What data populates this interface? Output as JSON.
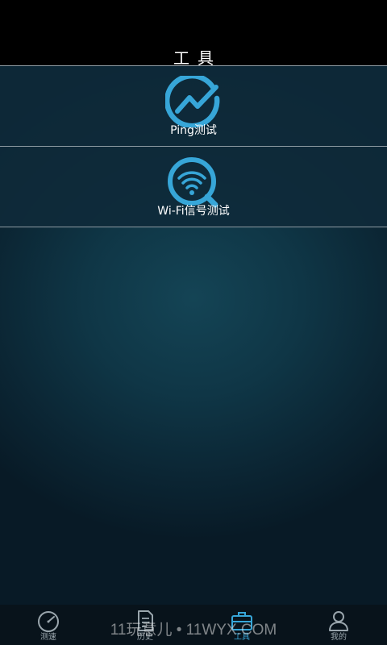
{
  "header": {
    "title": "工具"
  },
  "tools": [
    {
      "label": "Ping测试",
      "icon": "ping-chart-icon"
    },
    {
      "label": "Wi-Fi信号测试",
      "icon": "wifi-search-icon"
    }
  ],
  "bottom_nav": [
    {
      "label": "测速",
      "icon": "speedometer-icon",
      "active": false
    },
    {
      "label": "历史",
      "icon": "document-icon",
      "active": false
    },
    {
      "label": "工具",
      "icon": "toolbox-icon",
      "active": true
    },
    {
      "label": "我的",
      "icon": "user-icon",
      "active": false
    }
  ],
  "watermark": "11玩意儿 • 11WYX.COM",
  "colors": {
    "accent": "#37a6d8",
    "background": "#0b2533",
    "row_background": "#0e2a3a",
    "divider": "#8d9aa2",
    "nav_label": "#9aa6ad"
  }
}
